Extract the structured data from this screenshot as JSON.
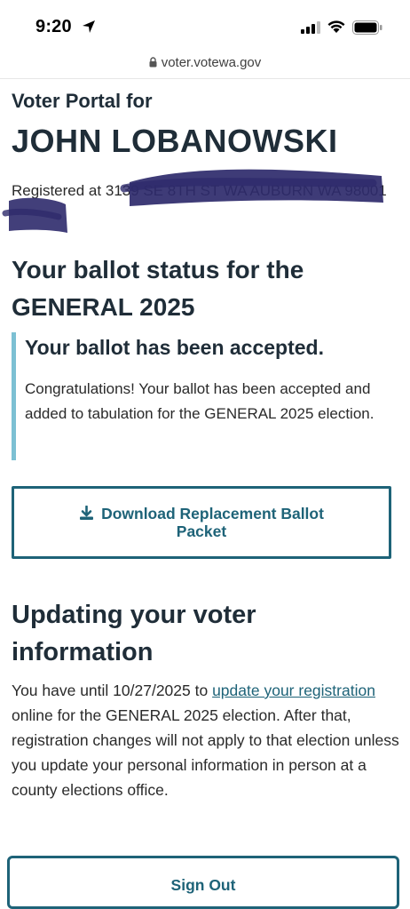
{
  "status_bar": {
    "time": "9:20"
  },
  "browser": {
    "url": "voter.votewa.gov"
  },
  "portal": {
    "title_prefix": "Voter Portal for",
    "voter_name": "JOHN LOBANOWSKI",
    "registered_label": "Registered at",
    "registered_address": "3139 SE 8TH ST WA AUBURN WA 98001"
  },
  "ballot": {
    "heading": "Your ballot status for the GENERAL 2025",
    "alert_title": "Your ballot has been accepted.",
    "alert_body": "Congratulations! Your ballot has been accepted and added to tabulation for the GENERAL 2025 election."
  },
  "download_button": {
    "label": "Download Replacement Ballot Packet"
  },
  "update_section": {
    "heading": "Updating your voter information",
    "text_before": "You have until 10/27/2025 to ",
    "link_text": "update your registration",
    "text_after": " online for the GENERAL 2025 election. After that, registration changes will not apply to that election unless you update your personal information in person at a county elections office."
  },
  "signout_button": {
    "label": "Sign Out"
  },
  "colors": {
    "accent": "#1e6378",
    "alert_border": "#7cc0d3",
    "heading": "#1f2d38",
    "redaction": "#2e2a6b"
  }
}
